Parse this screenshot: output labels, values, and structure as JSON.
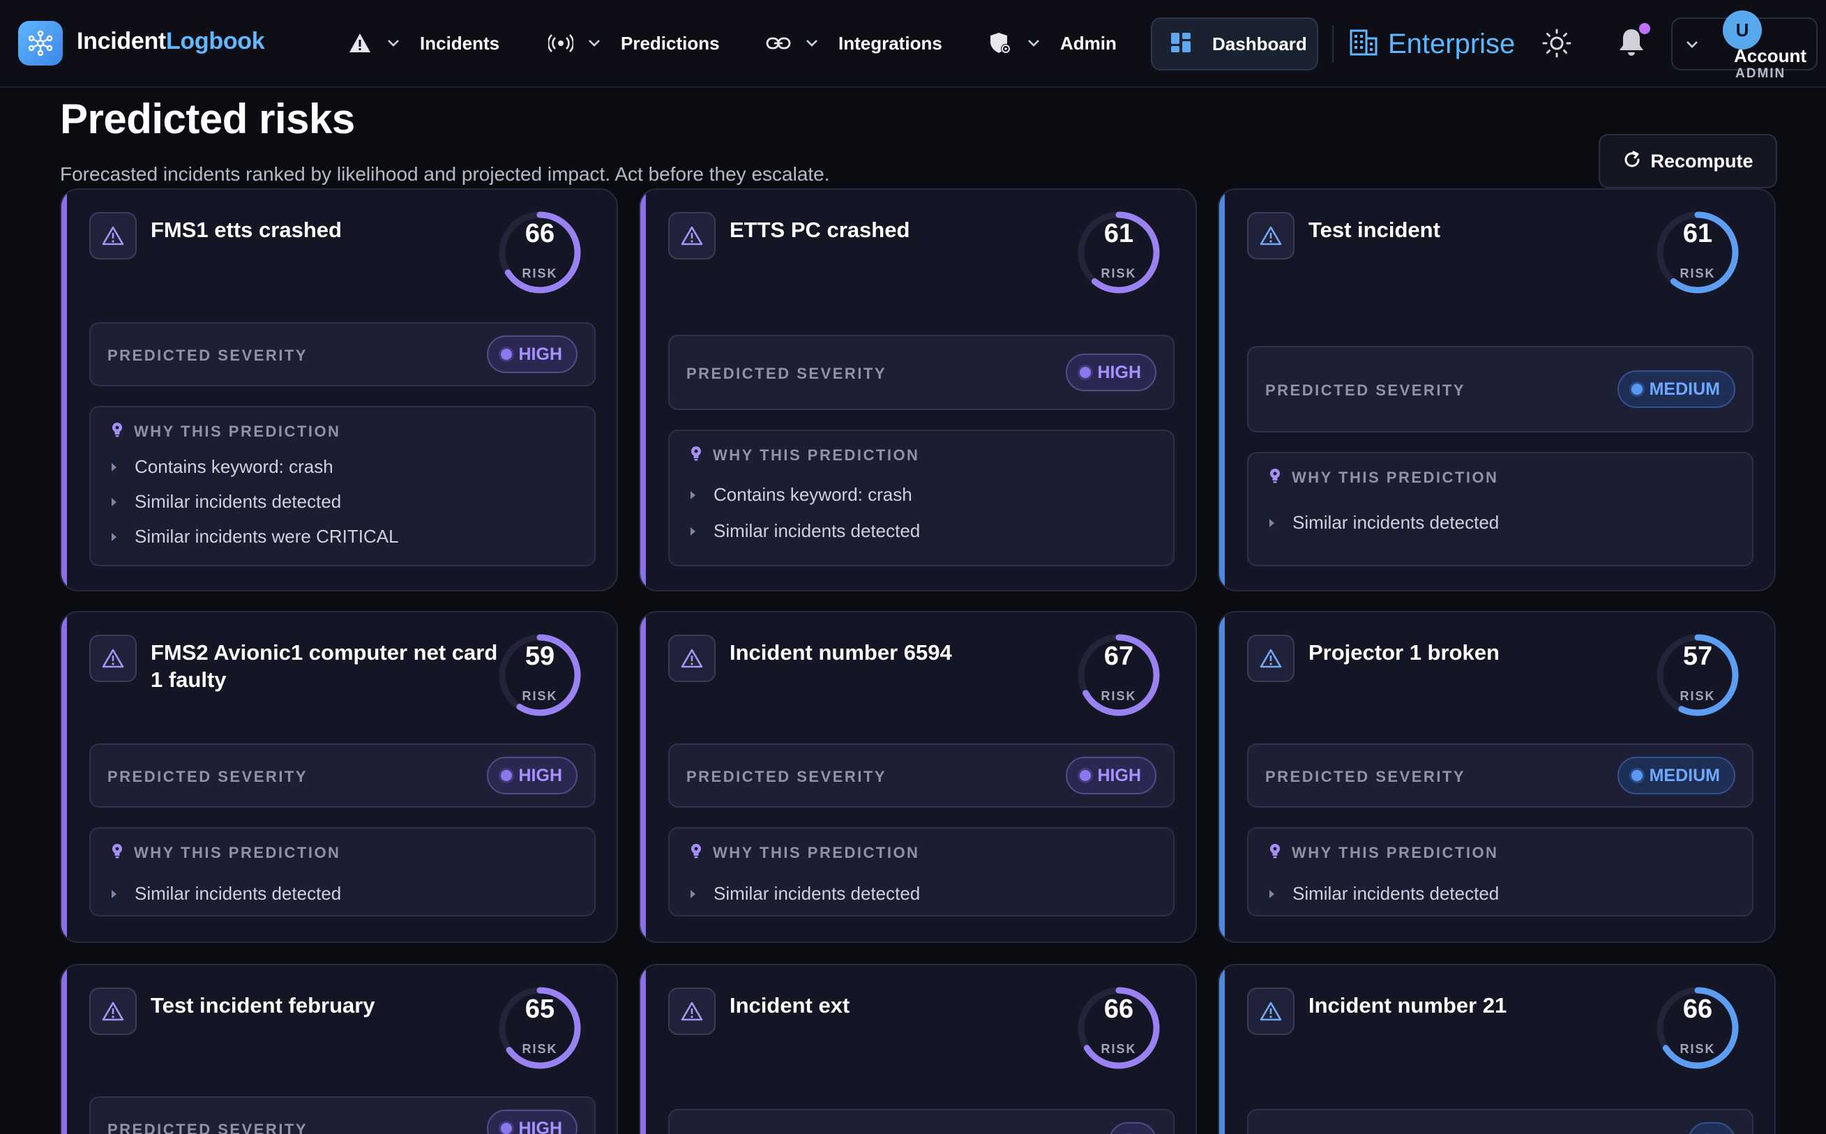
{
  "app": {
    "brand_part1": "Incident",
    "brand_part2": "Logbook",
    "logo_icon": "network-hub-icon"
  },
  "nav": {
    "items": [
      {
        "icon": "warning-triangle-icon",
        "label": "Incidents"
      },
      {
        "icon": "broadcast-icon",
        "label": "Predictions"
      },
      {
        "icon": "link-icon",
        "label": "Integrations"
      },
      {
        "icon": "shield-settings-icon",
        "label": "Admin"
      }
    ],
    "dashboard_label": "Dashboard",
    "plan_label": "Enterprise",
    "account": {
      "avatar_initial": "U",
      "name": "Account",
      "role": "ADMIN"
    }
  },
  "page": {
    "title": "Predicted risks",
    "subtitle": "Forecasted incidents ranked by likelihood and projected impact. Act before they escalate.",
    "recompute_label": "Recompute"
  },
  "labels": {
    "risk": "RISK",
    "predicted_severity": "PREDICTED SEVERITY",
    "why": "WHY THIS PREDICTION"
  },
  "colors": {
    "high_accent": "#8a6fe6",
    "medium_accent": "#4f8ae0",
    "brand_blue": "#62b8ff"
  },
  "cards": [
    {
      "title": "FMS1 etts crashed",
      "risk": 66,
      "severity": "HIGH",
      "reasons": [
        "Contains keyword: crash",
        "Similar incidents detected",
        "Similar incidents were CRITICAL"
      ]
    },
    {
      "title": "ETTS PC crashed",
      "risk": 61,
      "severity": "HIGH",
      "reasons": [
        "Contains keyword: crash",
        "Similar incidents detected"
      ]
    },
    {
      "title": "Test incident",
      "risk": 61,
      "severity": "MEDIUM",
      "reasons": [
        "Similar incidents detected"
      ]
    },
    {
      "title": "FMS2 Avionic1 computer net card 1 faulty",
      "risk": 59,
      "severity": "HIGH",
      "reasons": [
        "Similar incidents detected"
      ]
    },
    {
      "title": "Incident number 6594",
      "risk": 67,
      "severity": "HIGH",
      "reasons": [
        "Similar incidents detected"
      ]
    },
    {
      "title": "Projector 1 broken",
      "risk": 57,
      "severity": "MEDIUM",
      "reasons": [
        "Similar incidents detected"
      ]
    },
    {
      "title": "Test incident february",
      "risk": 65,
      "severity": "HIGH",
      "reasons": []
    },
    {
      "title": "Incident ext",
      "risk": 66,
      "severity": "",
      "reasons": []
    },
    {
      "title": "Incident number 21",
      "risk": 66,
      "severity": "",
      "reasons": []
    }
  ]
}
